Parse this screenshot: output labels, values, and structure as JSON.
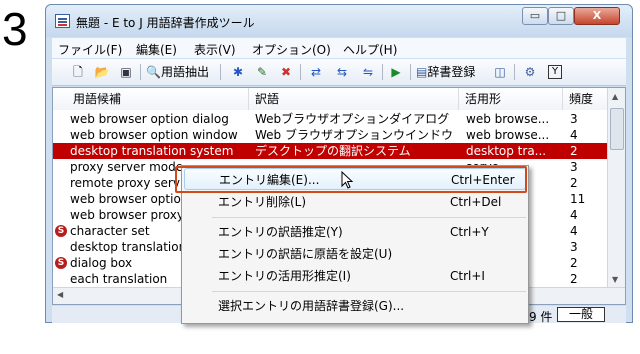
{
  "step_number": "3",
  "window": {
    "title": "無題 - E to J 用語辞書作成ツール",
    "controls": {
      "minimize": "▭",
      "maximize": "□",
      "close": "X"
    }
  },
  "menubar": [
    "ファイル(F)",
    "編集(E)",
    "表示(V)",
    "オプション(O)",
    "ヘルプ(H)"
  ],
  "toolbar": {
    "extract_terms": "用語抽出",
    "register_dictionary": "辞書登録",
    "icons": [
      "new-document-icon",
      "open-folder-icon",
      "save-icon",
      "extract-terms-icon",
      "mark-asterisk-icon",
      "edit-pencil-icon",
      "delete-x-icon",
      "translate-forward-icon",
      "translate-reverse-icon",
      "translate-both-icon",
      "run-arrow-icon",
      "dictionary-register-icon",
      "dictionary-view-icon",
      "settings-icon",
      "filter-y-icon"
    ]
  },
  "table": {
    "columns": [
      "用語候補",
      "訳語",
      "活用形",
      "頻度"
    ],
    "rows": [
      {
        "term": "web browser option dialog",
        "translation": "Webブラウザオプションダイアログ",
        "form": "web browse...",
        "freq": "3",
        "flag": ""
      },
      {
        "term": "web browser option window",
        "translation": "Web ブラウザオプションウインドウ",
        "form": "web browse...",
        "freq": "4",
        "flag": ""
      },
      {
        "term": "desktop translation system",
        "translation": "デスクトップの翻訳システム",
        "form": "desktop tra...",
        "freq": "2",
        "flag": "",
        "selected": true
      },
      {
        "term": "proxy server mode",
        "translation": "",
        "form": "serve...",
        "freq": "3",
        "flag": ""
      },
      {
        "term": "remote proxy serv",
        "translation": "",
        "form": "pro...",
        "freq": "2",
        "flag": ""
      },
      {
        "term": "web browser optior",
        "translation": "",
        "form": "owse...",
        "freq": "11",
        "flag": ""
      },
      {
        "term": "web browser proxy",
        "translation": "",
        "form": "owse...",
        "freq": "4",
        "flag": ""
      },
      {
        "term": "character set",
        "translation": "",
        "form": "ter sets",
        "freq": "4",
        "flag": "S"
      },
      {
        "term": "desktop translation",
        "translation": "",
        "form": "tra...",
        "freq": "3",
        "flag": ""
      },
      {
        "term": "dialog box",
        "translation": "",
        "form": "boxes",
        "freq": "2",
        "flag": "S"
      },
      {
        "term": "each translation",
        "translation": "",
        "form": "ransl...",
        "freq": "2",
        "flag": ""
      }
    ]
  },
  "status": {
    "count": "3 / 49 件",
    "mode": "一般"
  },
  "context_menu": [
    {
      "label": "エントリ編集(E)...",
      "shortcut": "Ctrl+Enter",
      "highlighted": true
    },
    {
      "label": "エントリ削除(L)",
      "shortcut": "Ctrl+Del"
    },
    {
      "separator": true
    },
    {
      "label": "エントリの訳語推定(Y)",
      "shortcut": "Ctrl+Y"
    },
    {
      "label": "エントリの訳語に原語を設定(U)",
      "shortcut": ""
    },
    {
      "label": "エントリの活用形推定(I)",
      "shortcut": "Ctrl+I"
    },
    {
      "separator": true
    },
    {
      "label": "選択エントリの用語辞書登録(G)...",
      "shortcut": ""
    }
  ],
  "colors": {
    "selection": "#c00000",
    "highlight_frame": "#d04a1c",
    "accent": "#3a5f9e"
  }
}
